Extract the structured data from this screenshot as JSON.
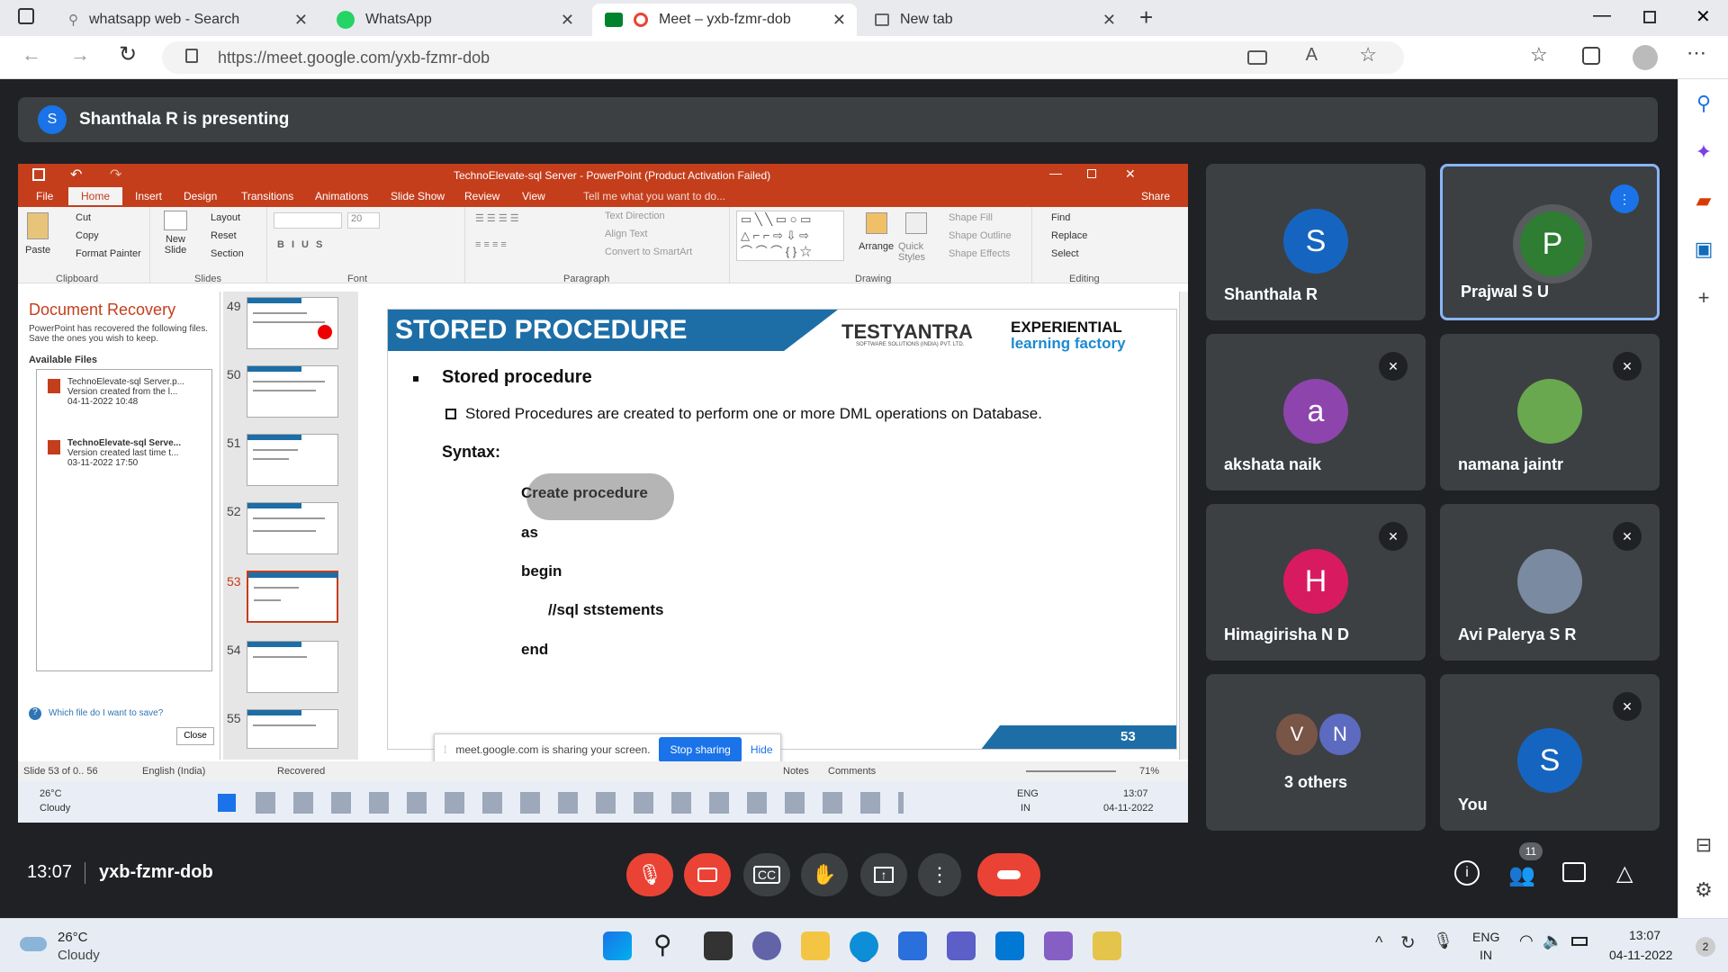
{
  "browser": {
    "tabs": [
      {
        "title": "whatsapp web - Search",
        "icon": "search-icon"
      },
      {
        "title": "WhatsApp",
        "icon": "whatsapp-icon"
      },
      {
        "title": "Meet – yxb-fzmr-dob",
        "icon": "meet-icon"
      },
      {
        "title": "New tab",
        "icon": "newtab-icon"
      }
    ],
    "url": "https://meet.google.com/yxb-fzmr-dob"
  },
  "meet": {
    "presenter_initial": "S",
    "presenting_text": "Shanthala R is presenting",
    "time": "13:07",
    "meeting_code": "yxb-fzmr-dob",
    "participant_count": "11",
    "participants": [
      {
        "name": "Shanthala R",
        "initial": "S",
        "color": "#1565c0"
      },
      {
        "name": "Prajwal S U",
        "initial": "P",
        "color": "#2e7d32"
      },
      {
        "name": "akshata naik",
        "initial": "a",
        "color": "#8e44ad"
      },
      {
        "name": "namana jaintr",
        "initial": "",
        "color": "#6aa84f"
      },
      {
        "name": "Himagirisha N D",
        "initial": "H",
        "color": "#d81b60"
      },
      {
        "name": "Avi Palerya S R",
        "initial": "",
        "color": "#7a8aa0"
      },
      {
        "name": "3 others",
        "initials": [
          "V",
          "N"
        ],
        "colors": [
          "#795548",
          "#5c6bc0"
        ]
      },
      {
        "name": "You",
        "initial": "S",
        "color": "#1565c0"
      }
    ]
  },
  "ppt": {
    "title": "TechnoElevate-sql Server - PowerPoint (Product Activation Failed)",
    "tabs": [
      "File",
      "Home",
      "Insert",
      "Design",
      "Transitions",
      "Animations",
      "Slide Show",
      "Review",
      "View",
      "Tell me what you want to do...",
      "Share"
    ],
    "ribbon": {
      "paste": "Paste",
      "cut": "Cut",
      "copy": "Copy",
      "format_painter": "Format Painter",
      "clipboard": "Clipboard",
      "new_slide": "New Slide",
      "layout": "Layout",
      "reset": "Reset",
      "section": "Section",
      "slides": "Slides",
      "font_size": "20",
      "font": "Font",
      "paragraph": "Paragraph",
      "text_direction": "Text Direction",
      "align_text": "Align Text",
      "convert_smartart": "Convert to SmartArt",
      "drawing": "Drawing",
      "arrange": "Arrange",
      "quick_styles": "Quick Styles",
      "shape_fill": "Shape Fill",
      "shape_outline": "Shape Outline",
      "shape_effects": "Shape Effects",
      "find": "Find",
      "replace": "Replace",
      "select": "Select",
      "editing": "Editing"
    },
    "doc_recovery": {
      "title": "Document Recovery",
      "desc": "PowerPoint has recovered the following files.  Save the ones you wish to keep.",
      "available": "Available Files",
      "files": [
        {
          "name": "TechnoElevate-sql Server.p...",
          "l2": "Version created from the l...",
          "l3": "04-11-2022 10:48"
        },
        {
          "name": "TechnoElevate-sql Serve...",
          "l2": "Version created last time t...",
          "l3": "03-11-2022 17:50"
        }
      ],
      "help": "Which file do I want to save?",
      "close": "Close"
    },
    "thumbs": [
      "49",
      "50",
      "51",
      "52",
      "53",
      "54",
      "55"
    ],
    "slide": {
      "header": "STORED PROCEDURE",
      "logo1": "TESTYANTRA",
      "logo1_sub": "SOFTWARE SOLUTIONS (INDIA) PVT. LTD.",
      "logo2a": "EXPERIENTIAL",
      "logo2b": "learning factory",
      "bullet": "Stored procedure",
      "sub": "Stored Procedures are created to perform one or more DML operations on Database.",
      "syntax": "Syntax:",
      "code": [
        "Create procedure",
        "as",
        "begin",
        "//sql ststements",
        "end"
      ],
      "page": "53"
    },
    "status": {
      "slide": "Slide 53 of 0.. 56",
      "lang": "English (India)",
      "recovered": "Recovered",
      "notes": "Notes",
      "comments": "Comments",
      "zoom": "71%"
    },
    "share_notice": "meet.google.com is sharing your screen.",
    "stop_sharing": "Stop sharing",
    "hide": "Hide",
    "weather": {
      "temp": "26°C",
      "cond": "Cloudy"
    },
    "tray": {
      "lang1": "ENG",
      "lang2": "IN",
      "time": "13:07",
      "date": "04-11-2022"
    }
  },
  "taskbar": {
    "temp": "26°C",
    "cond": "Cloudy",
    "lang1": "ENG",
    "lang2": "IN",
    "time": "13:07",
    "date": "04-11-2022",
    "badge": "2"
  }
}
